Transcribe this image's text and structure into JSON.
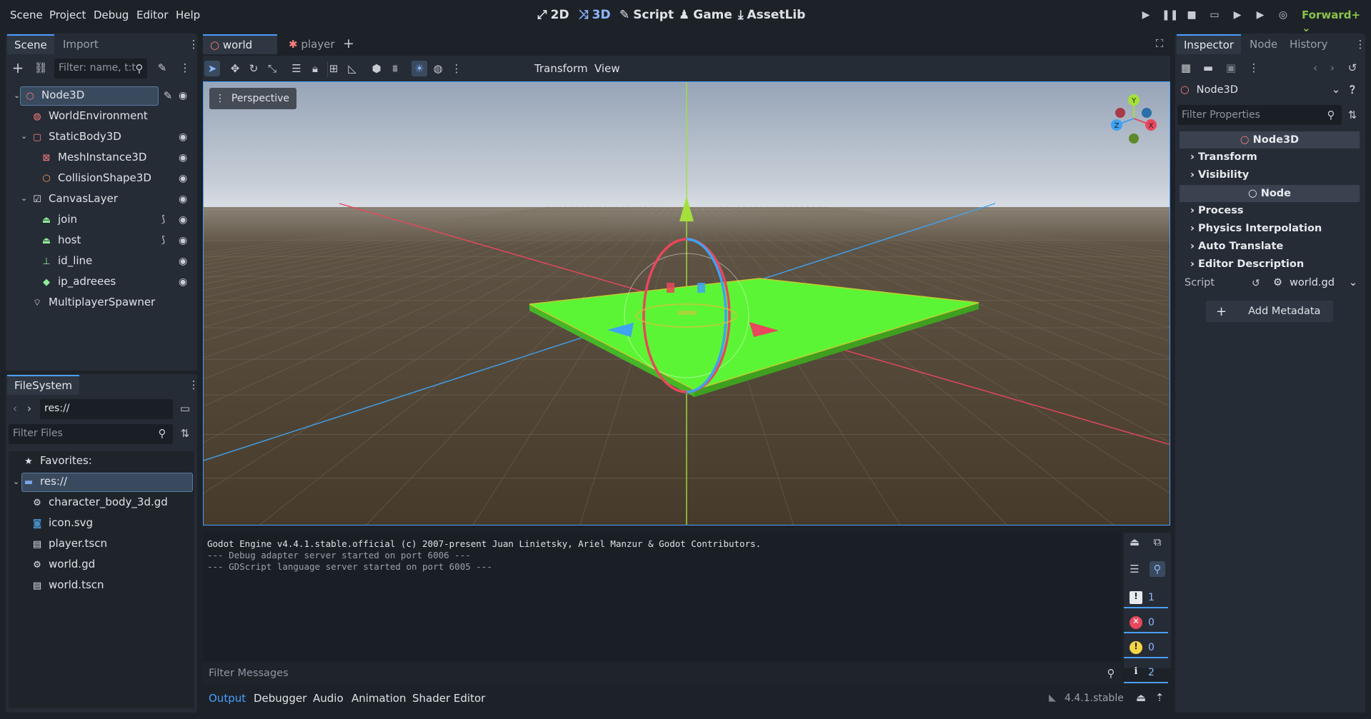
{
  "menu": {
    "items": [
      "Scene",
      "Project",
      "Debug",
      "Editor",
      "Help"
    ],
    "workspaces": {
      "2d": "2D",
      "3d": "3D",
      "script": "Script",
      "game": "Game",
      "assetlib": "AssetLib"
    },
    "renderer": "Forward+"
  },
  "scene_dock": {
    "tabs": {
      "scene": "Scene",
      "import": "Import"
    },
    "filter_placeholder": "Filter: name, t:t",
    "nodes": [
      {
        "label": "Node3D",
        "icon": "node3d-icon"
      },
      {
        "label": "WorldEnvironment",
        "icon": "world-environment-icon"
      },
      {
        "label": "StaticBody3D",
        "icon": "static-body-icon"
      },
      {
        "label": "MeshInstance3D",
        "icon": "mesh-instance-icon"
      },
      {
        "label": "CollisionShape3D",
        "icon": "collision-shape-icon"
      },
      {
        "label": "CanvasLayer",
        "icon": "canvas-layer-icon"
      },
      {
        "label": "join",
        "icon": "button-icon"
      },
      {
        "label": "host",
        "icon": "button-icon"
      },
      {
        "label": "id_line",
        "icon": "line-edit-icon"
      },
      {
        "label": "ip_adreees",
        "icon": "label-icon"
      },
      {
        "label": "MultiplayerSpawner",
        "icon": "spawner-icon"
      }
    ]
  },
  "filesystem": {
    "tab": "FileSystem",
    "path": "res://",
    "filter_placeholder": "Filter Files",
    "favorites": "Favorites:",
    "root": "res://",
    "files": [
      {
        "label": "character_body_3d.gd",
        "icon": "gear-icon"
      },
      {
        "label": "icon.svg",
        "icon": "image-icon"
      },
      {
        "label": "player.tscn",
        "icon": "scene-file-icon"
      },
      {
        "label": "world.gd",
        "icon": "gear-icon"
      },
      {
        "label": "world.tscn",
        "icon": "scene-file-icon"
      }
    ]
  },
  "editor_tabs": {
    "world": "world",
    "player": "player"
  },
  "viewport": {
    "menu_transform": "Transform",
    "menu_view": "View",
    "perspective": "Perspective",
    "gizmo": {
      "y": "Y",
      "x": "X",
      "z": "Z"
    }
  },
  "output": {
    "lines": [
      "Godot Engine v4.4.1.stable.official (c) 2007-present Juan Linietsky, Ariel Manzur & Godot Contributors.",
      "--- Debug adapter server started on port 6006 ---",
      "--- GDScript language server started on port 6005 ---"
    ],
    "filter_placeholder": "Filter Messages",
    "counts": {
      "messages": "1",
      "errors": "0",
      "warnings": "0",
      "info": "2"
    }
  },
  "bottom_tabs": {
    "output": "Output",
    "debugger": "Debugger",
    "audio": "Audio",
    "animation": "Animation",
    "shader": "Shader Editor"
  },
  "version": "4.4.1.stable",
  "inspector": {
    "tabs": {
      "inspector": "Inspector",
      "node": "Node",
      "history": "History"
    },
    "selected_node": "Node3D",
    "filter_placeholder": "Filter Properties",
    "class_node3d": "Node3D",
    "sections1": [
      "Transform",
      "Visibility"
    ],
    "class_node": "Node",
    "sections2": [
      "Process",
      "Physics Interpolation",
      "Auto Translate",
      "Editor Description"
    ],
    "script_label": "Script",
    "script_value": "world.gd",
    "add_metadata": "Add Metadata"
  },
  "colors": {
    "accent": "#4a9eff",
    "ground": "#4a3f30",
    "floor": "#5cf535",
    "axis_x": "#e8475c",
    "axis_z": "#3fa2f2",
    "axis_y": "#a5e03a"
  }
}
